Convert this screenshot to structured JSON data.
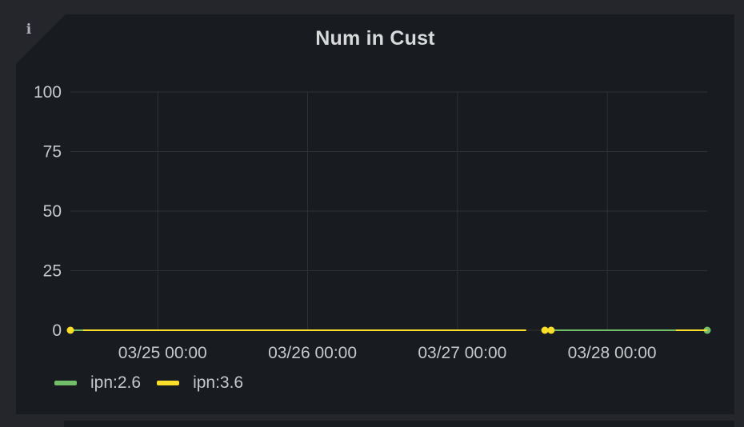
{
  "panel": {
    "info_icon": "info-icon",
    "info_glyph": "i"
  },
  "colors": {
    "panel_bg": "#181b1f",
    "grid": "#2f3136",
    "series_green": "#73bf69",
    "series_yellow": "#fade2a"
  },
  "chart_data": {
    "type": "line",
    "title": "Num in Cust",
    "xlabel": "",
    "ylabel": "",
    "ylim": [
      0,
      100
    ],
    "yticks": [
      0,
      25,
      50,
      75,
      100
    ],
    "ytick_labels": [
      "0",
      "25",
      "50",
      "75",
      "100"
    ],
    "xlim": [
      "2025-03-24 10:00",
      "2025-03-28 16:00"
    ],
    "xticks": [
      "2025-03-25 00:00",
      "2025-03-26 00:00",
      "2025-03-27 00:00",
      "2025-03-28 00:00"
    ],
    "xtick_labels": [
      "03/25 00:00",
      "03/26 00:00",
      "03/27 00:00",
      "03/28 00:00"
    ],
    "grid": true,
    "legend_position": "bottom-left",
    "series": [
      {
        "name": "ipn:2.6",
        "color": "#73bf69",
        "segments": [
          [
            [
              "2025-03-24 10:00",
              0
            ],
            [
              "2025-03-24 12:00",
              0
            ]
          ],
          [
            [
              "2025-03-27 15:00",
              0
            ],
            [
              "2025-03-28 11:00",
              0
            ]
          ],
          [
            [
              "2025-03-28 16:00",
              0
            ]
          ]
        ]
      },
      {
        "name": "ipn:3.6",
        "color": "#fade2a",
        "segments": [
          [
            [
              "2025-03-24 10:00",
              0
            ]
          ],
          [
            [
              "2025-03-24 12:00",
              0
            ],
            [
              "2025-03-27 11:00",
              0
            ]
          ],
          [
            [
              "2025-03-27 14:00",
              0
            ]
          ],
          [
            [
              "2025-03-27 15:00",
              0
            ]
          ],
          [
            [
              "2025-03-28 11:00",
              0
            ],
            [
              "2025-03-28 16:00",
              0
            ]
          ]
        ]
      }
    ]
  }
}
